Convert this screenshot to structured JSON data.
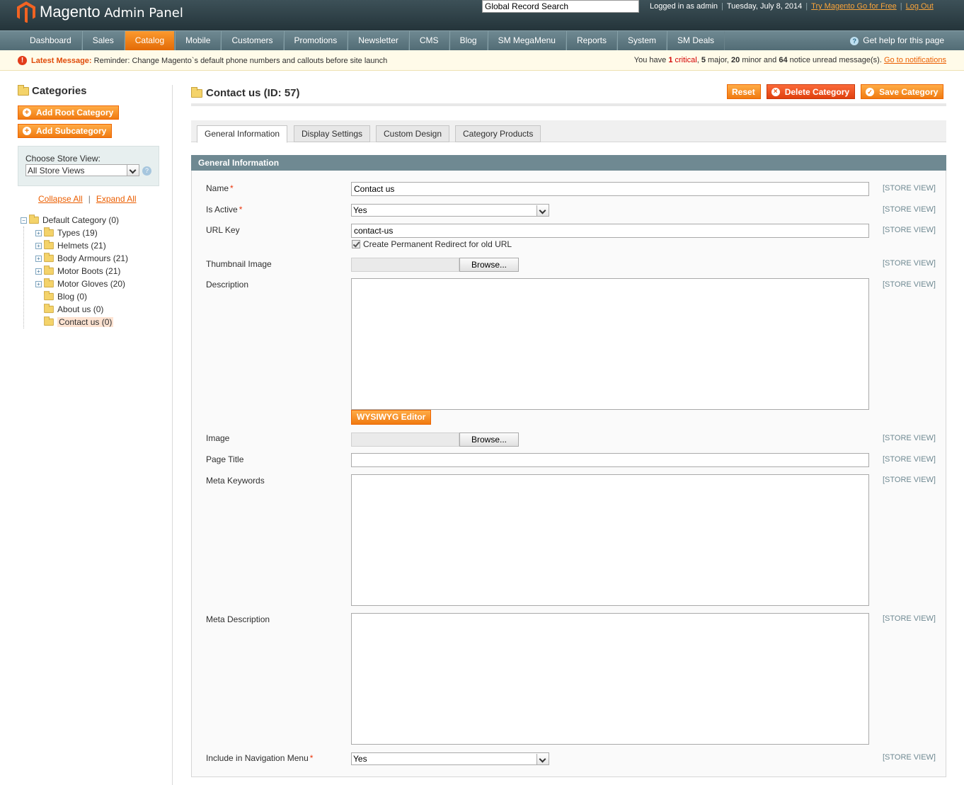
{
  "header": {
    "logo_text": "Magento",
    "logo_sub": "Admin Panel",
    "search_value": "Global Record Search",
    "logged_in": "Logged in as admin",
    "date": "Tuesday, July 8, 2014",
    "try_link": "Try Magento Go for Free",
    "logout": "Log Out"
  },
  "nav": {
    "items": [
      "Dashboard",
      "Sales",
      "Catalog",
      "Mobile",
      "Customers",
      "Promotions",
      "Newsletter",
      "CMS",
      "Blog",
      "SM MegaMenu",
      "Reports",
      "System",
      "SM Deals"
    ],
    "active": "Catalog",
    "help": "Get help for this page"
  },
  "message": {
    "label": "Latest Message:",
    "text": "Reminder: Change Magento`s default phone numbers and callouts before site launch",
    "right_prefix": "You have",
    "critical_count": "1",
    "critical_label": "critical",
    "major": "5",
    "major_label": "major,",
    "minor": "20",
    "minor_label": "minor and",
    "notice": "64",
    "notice_label": "notice unread message(s).",
    "link": "Go to notifications"
  },
  "left": {
    "title": "Categories",
    "add_root": "Add Root Category",
    "add_sub": "Add Subcategory",
    "store_view_label": "Choose Store View:",
    "store_view_value": "All Store Views",
    "collapse_all": "Collapse All",
    "expand_all": "Expand All",
    "tree_root": "Default Category (0)",
    "tree": [
      {
        "label": "Types (19)",
        "expandable": true
      },
      {
        "label": "Helmets (21)",
        "expandable": true
      },
      {
        "label": "Body Armours (21)",
        "expandable": true
      },
      {
        "label": "Motor Boots (21)",
        "expandable": true
      },
      {
        "label": "Motor Gloves (20)",
        "expandable": true
      },
      {
        "label": "Blog (0)",
        "expandable": false
      },
      {
        "label": "About us (0)",
        "expandable": false
      },
      {
        "label": "Contact us (0)",
        "expandable": false,
        "selected": true
      }
    ]
  },
  "main": {
    "title": "Contact us (ID: 57)",
    "buttons": {
      "reset": "Reset",
      "delete": "Delete Category",
      "save": "Save Category"
    },
    "tabs": [
      "General Information",
      "Display Settings",
      "Custom Design",
      "Category Products"
    ],
    "section": "General Information",
    "store_view_tag": "[STORE VIEW]",
    "fields": {
      "name_label": "Name",
      "name_value": "Contact us",
      "active_label": "Is Active",
      "active_value": "Yes",
      "url_label": "URL Key",
      "url_value": "contact-us",
      "redirect_label": "Create Permanent Redirect for old URL",
      "thumb_label": "Thumbnail Image",
      "browse": "Browse...",
      "desc_label": "Description",
      "wysiwyg": "WYSIWYG Editor",
      "image_label": "Image",
      "page_title_label": "Page Title",
      "meta_kw_label": "Meta Keywords",
      "meta_desc_label": "Meta Description",
      "nav_label": "Include in Navigation Menu",
      "nav_value": "Yes"
    },
    "required_mark": "*"
  },
  "colors": {
    "accent": "#f07a10",
    "header": "#2a3b40",
    "nav": "#6f8992"
  }
}
